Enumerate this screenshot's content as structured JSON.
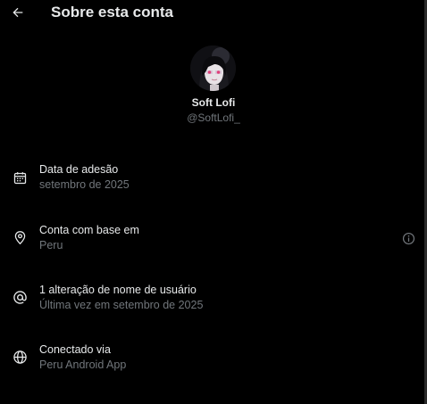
{
  "header": {
    "back_icon": "arrow-left-icon",
    "title": "Sobre esta conta"
  },
  "profile": {
    "avatar_icon": "avatar-anime-girl",
    "display_name": "Soft Lofi",
    "handle": "@SoftLofi_"
  },
  "items": [
    {
      "icon": "calendar-icon",
      "label": "Data de adesão",
      "value": "setembro de 2025"
    },
    {
      "icon": "location-pin-icon",
      "label": "Conta com base em",
      "value": "Peru",
      "info_icon": "info-icon"
    },
    {
      "icon": "at-sign-icon",
      "label": "1 alteração de nome de usuário",
      "value": "Última vez em setembro de 2025"
    },
    {
      "icon": "globe-icon",
      "label": "Conectado via",
      "value": "Peru Android App"
    }
  ],
  "colors": {
    "background": "#000000",
    "primary_text": "#e7e9ea",
    "secondary_text": "#71767b"
  }
}
